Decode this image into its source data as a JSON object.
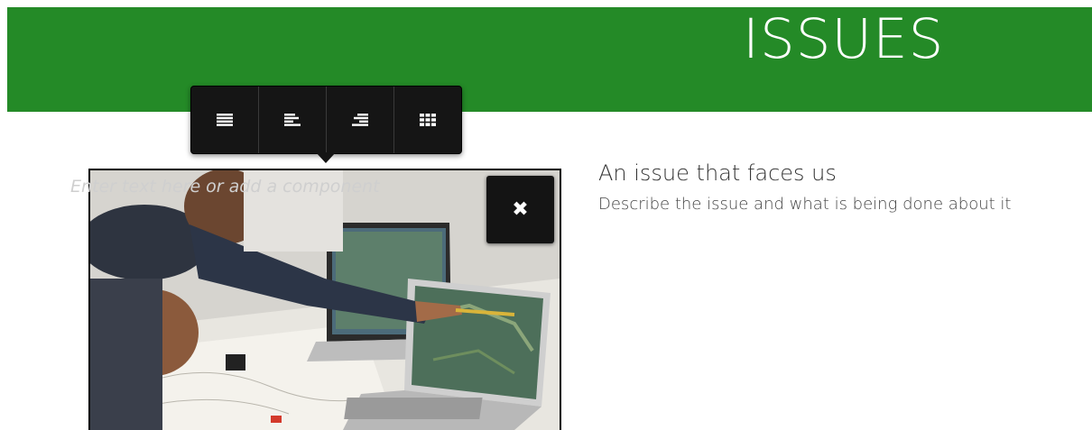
{
  "header": {
    "title": "ISSUES",
    "color": "#248a27"
  },
  "toolbar": {
    "buttons": [
      {
        "name": "justify",
        "icon": "align-justify-icon"
      },
      {
        "name": "left",
        "icon": "align-left-icon"
      },
      {
        "name": "right",
        "icon": "align-right-icon"
      },
      {
        "name": "grid",
        "icon": "grid-icon"
      }
    ]
  },
  "component": {
    "placeholder": "Enter text here or add a component",
    "close_icon": "close-icon",
    "close_label": "✖"
  },
  "issue": {
    "title": "An issue that faces us",
    "description": "Describe the issue and what is being done about it"
  }
}
